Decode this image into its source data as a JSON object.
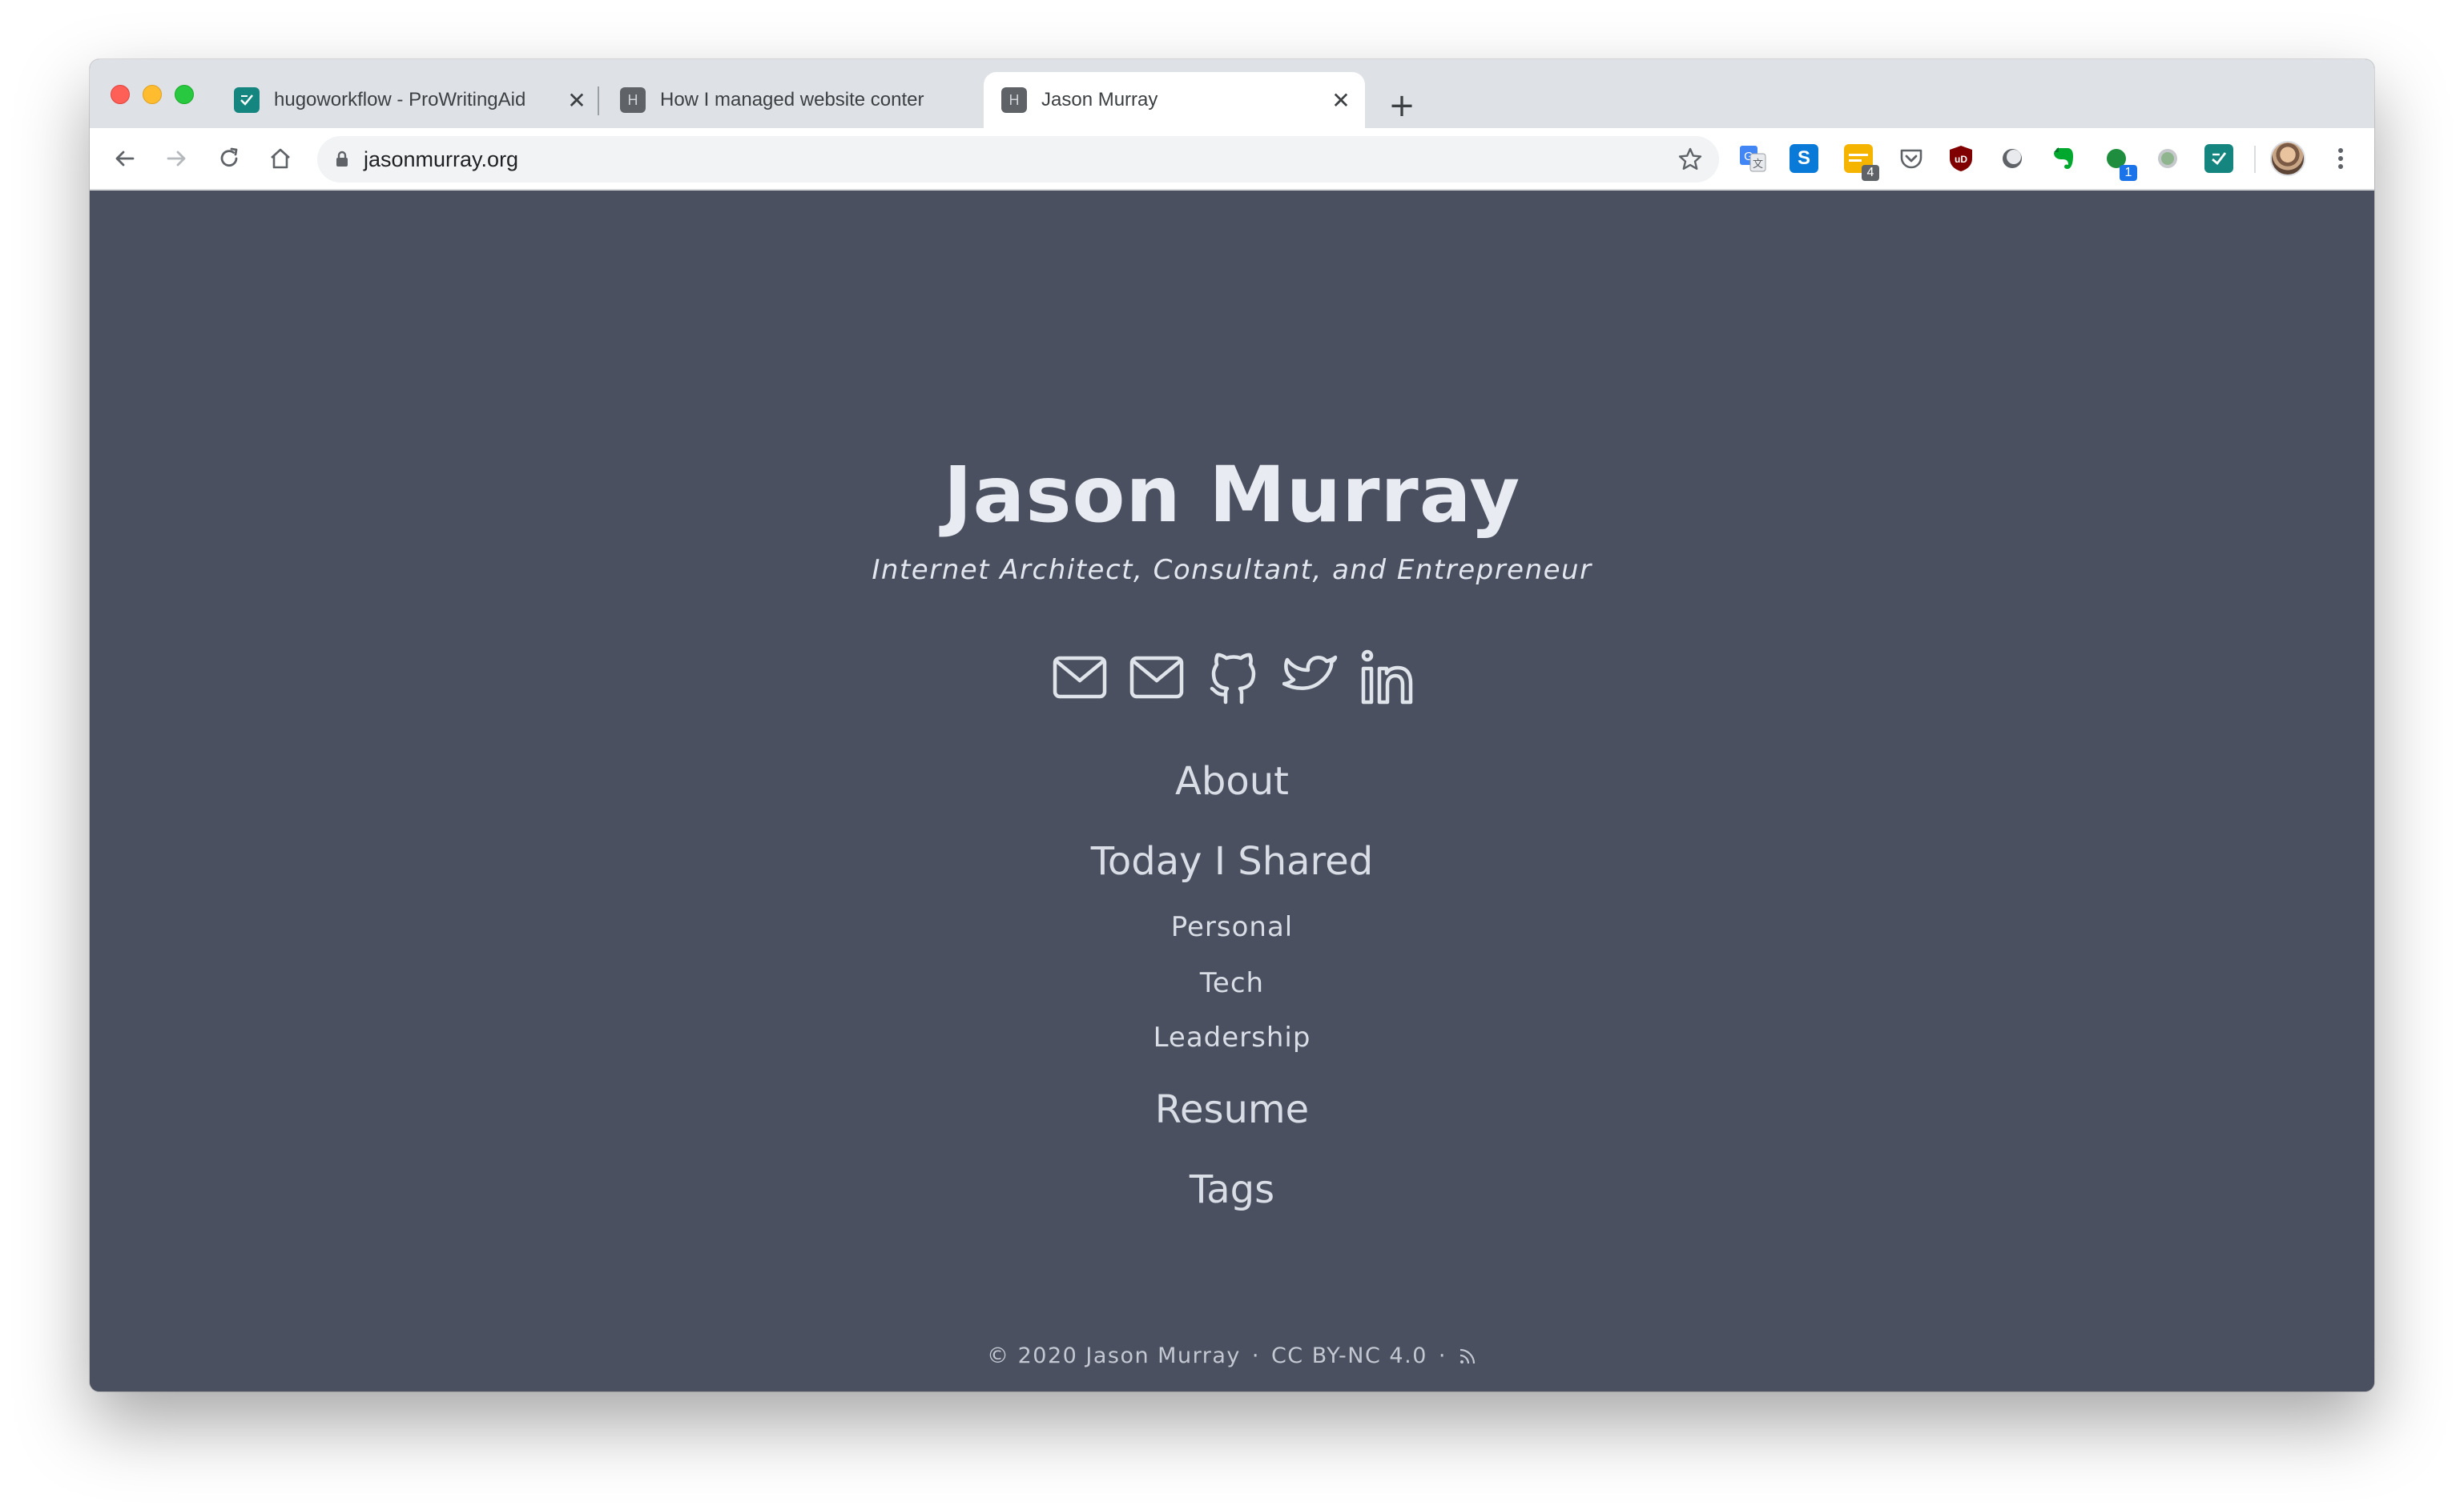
{
  "browser": {
    "tabs": [
      {
        "title": "hugoworkflow - ProWritingAid",
        "favicon": "prowritingaid-icon"
      },
      {
        "title": "How I managed website conter",
        "favicon": "h-letter-icon",
        "favicon_letter": "H"
      },
      {
        "title": "Jason Murray",
        "favicon": "h-letter-icon",
        "favicon_letter": "H",
        "active": true
      }
    ],
    "new_tab_label": "+",
    "close_glyph": "✕",
    "url": "jasonmurray.org",
    "extensions": [
      {
        "name": "google-translate-icon"
      },
      {
        "name": "skype-icon",
        "glyph": "S",
        "color": "#0a7ad8"
      },
      {
        "name": "keep-icon",
        "badge": "4",
        "color": "#f4b400"
      },
      {
        "name": "pocket-icon"
      },
      {
        "name": "ublock-icon",
        "glyph": "uD",
        "color": "#800000"
      },
      {
        "name": "dark-reader-icon"
      },
      {
        "name": "evernote-icon",
        "color": "#00a82d"
      },
      {
        "name": "green-circle-extension-icon",
        "badge": "1",
        "color": "#1e8e3e"
      },
      {
        "name": "grey-circle-extension-icon",
        "color": "#9fb39f"
      },
      {
        "name": "prowritingaid-extension-icon",
        "color": "#14867f"
      }
    ]
  },
  "site": {
    "title": "Jason Murray",
    "subtitle": "Internet Architect, Consultant, and Entrepreneur",
    "social": [
      "email-icon",
      "email-icon",
      "github-icon",
      "twitter-icon",
      "linkedin-icon"
    ],
    "nav": {
      "about": "About",
      "til": "Today I Shared",
      "personal": "Personal",
      "tech": "Tech",
      "leadership": "Leadership",
      "resume": "Resume",
      "tags": "Tags"
    },
    "footer": {
      "copyright": "© 2020 Jason Murray",
      "sep1": "·",
      "license": "CC BY-NC 4.0",
      "sep2": "·",
      "rss_icon": "rss-icon"
    },
    "colors": {
      "page_bg": "#4b5060",
      "text": "#d8dde6"
    }
  }
}
